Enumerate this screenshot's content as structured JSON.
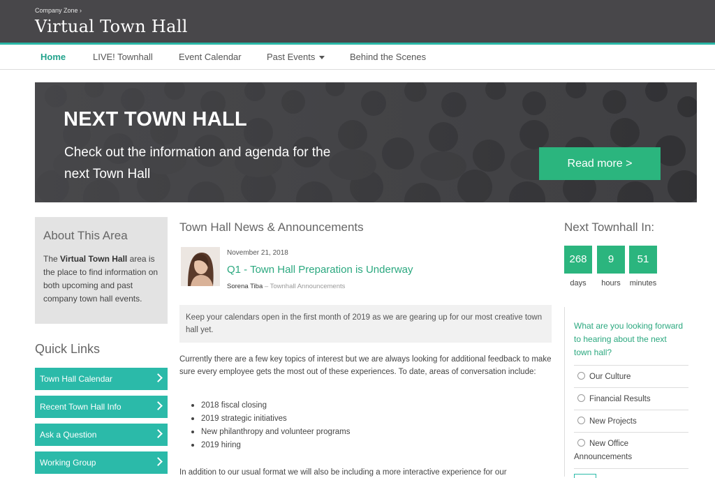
{
  "header": {
    "breadcrumb": "Company Zone ›",
    "title": "Virtual Town Hall"
  },
  "nav": {
    "items": [
      {
        "label": "Home",
        "active": true
      },
      {
        "label": "LIVE! Townhall"
      },
      {
        "label": "Event Calendar"
      },
      {
        "label": "Past Events",
        "has_dropdown": true
      },
      {
        "label": "Behind the Scenes"
      }
    ]
  },
  "hero": {
    "title": "NEXT TOWN HALL",
    "text": "Check out the information and agenda for the next Town Hall",
    "button": "Read more >"
  },
  "about": {
    "title": "About This Area",
    "text_pre": "The ",
    "text_bold": "Virtual Town Hall",
    "text_post": " area is the place to find information on both upcoming and past company town hall events."
  },
  "quick_links": {
    "title": "Quick Links",
    "items": [
      "Town Hall Calendar",
      "Recent Town Hall Info",
      "Ask a Question",
      "Working Group"
    ]
  },
  "news": {
    "title": "Town Hall News & Announcements",
    "post": {
      "date": "November 21, 2018",
      "title": "Q1 - Town Hall Preparation is Underway",
      "author": "Sorena Tiba",
      "separator": " – ",
      "category": "Townhall Announcements",
      "excerpt": "Keep your calendars open in the first month of 2019 as we are gearing up for our most creative town hall yet.",
      "paragraph1": "Currently there are a few key topics of interest but we are always looking for additional feedback to make sure every employee gets the most out of these experiences. To date, areas of conversation include:",
      "bullets": [
        "2018 fiscal closing",
        "2019 strategic initiatives",
        "New philanthropy and volunteer programs",
        "2019 hiring"
      ],
      "paragraph2": "In addition to our usual format we will also be including a more interactive experience for our"
    }
  },
  "countdown": {
    "title": "Next Townhall In:",
    "units": [
      {
        "value": "268",
        "label": "days"
      },
      {
        "value": "9",
        "label": "hours"
      },
      {
        "value": "51",
        "label": "minutes"
      }
    ]
  },
  "poll": {
    "question": "What are you looking forward to hearing about the next town hall?",
    "options": [
      "Our Culture",
      "Financial Results",
      "New Projects",
      "New Office Announcements"
    ]
  },
  "colors": {
    "header_bg": "#48474a",
    "accent_teal": "#2bbaa9",
    "accent_green": "#2bb57e",
    "link_green": "#2ba87f"
  }
}
